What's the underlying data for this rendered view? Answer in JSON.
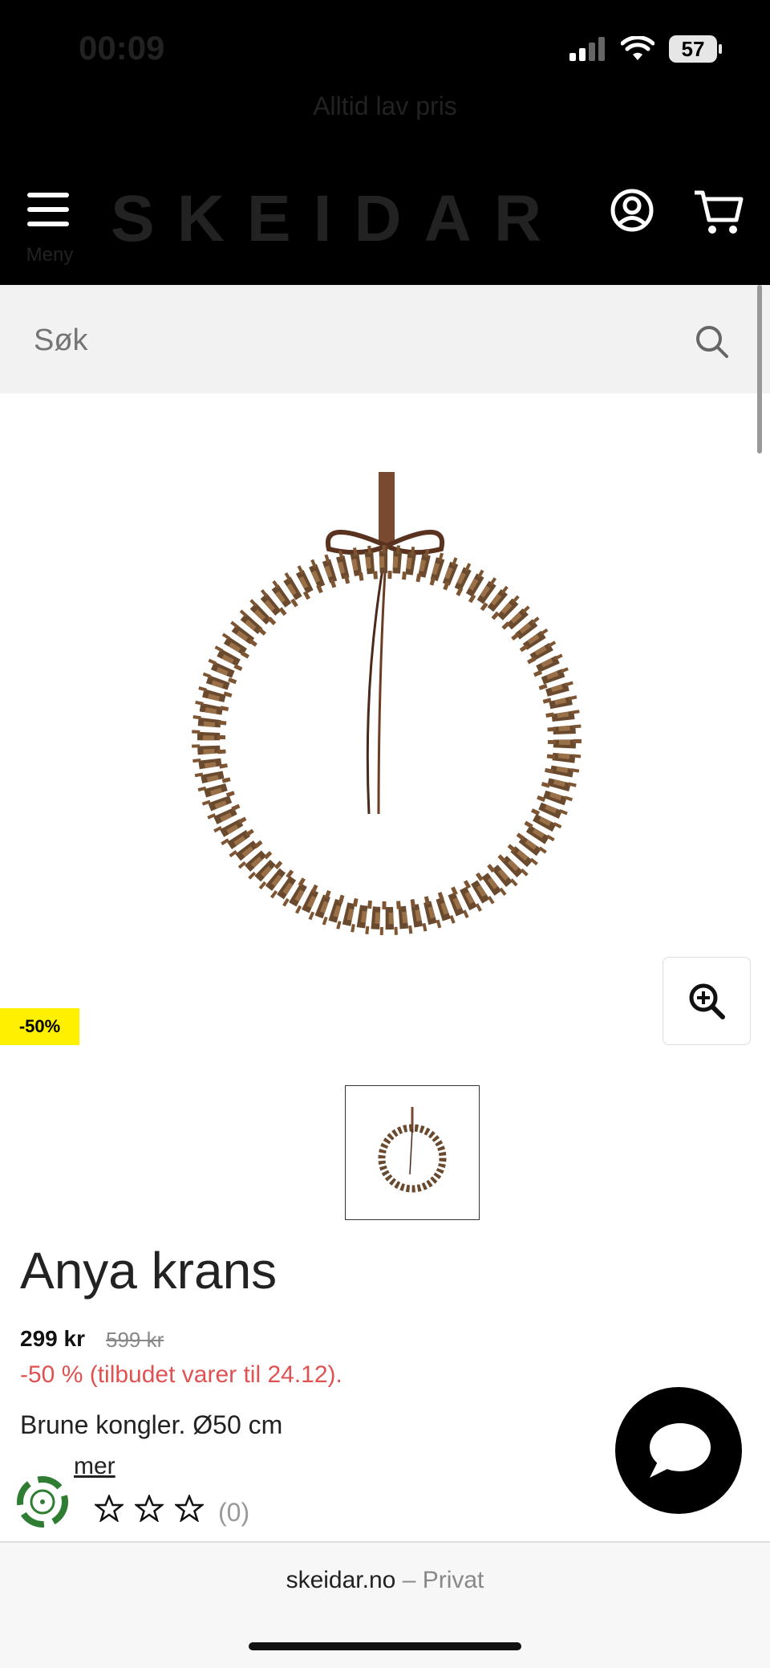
{
  "status_bar": {
    "time": "00:09",
    "battery": "57"
  },
  "header": {
    "promo": "Alltid lav pris",
    "menu_label": "Meny",
    "logo": "SKEIDAR"
  },
  "search": {
    "placeholder": "Søk"
  },
  "product": {
    "discount_badge": "-50%",
    "title": "Anya krans",
    "price": "299 kr",
    "old_price": "599 kr",
    "offer_text": "-50 % (tilbudet varer til 24.12).",
    "description": "Brune kongler. Ø50 cm",
    "read_more": "mer",
    "rating_count": "(0)",
    "rating_value": 0,
    "rating_max": 5
  },
  "browser": {
    "domain": "skeidar.no",
    "mode": "– Privat"
  },
  "colors": {
    "header_bg": "#000000",
    "badge_bg": "#fff000",
    "offer_text": "#e05252"
  }
}
